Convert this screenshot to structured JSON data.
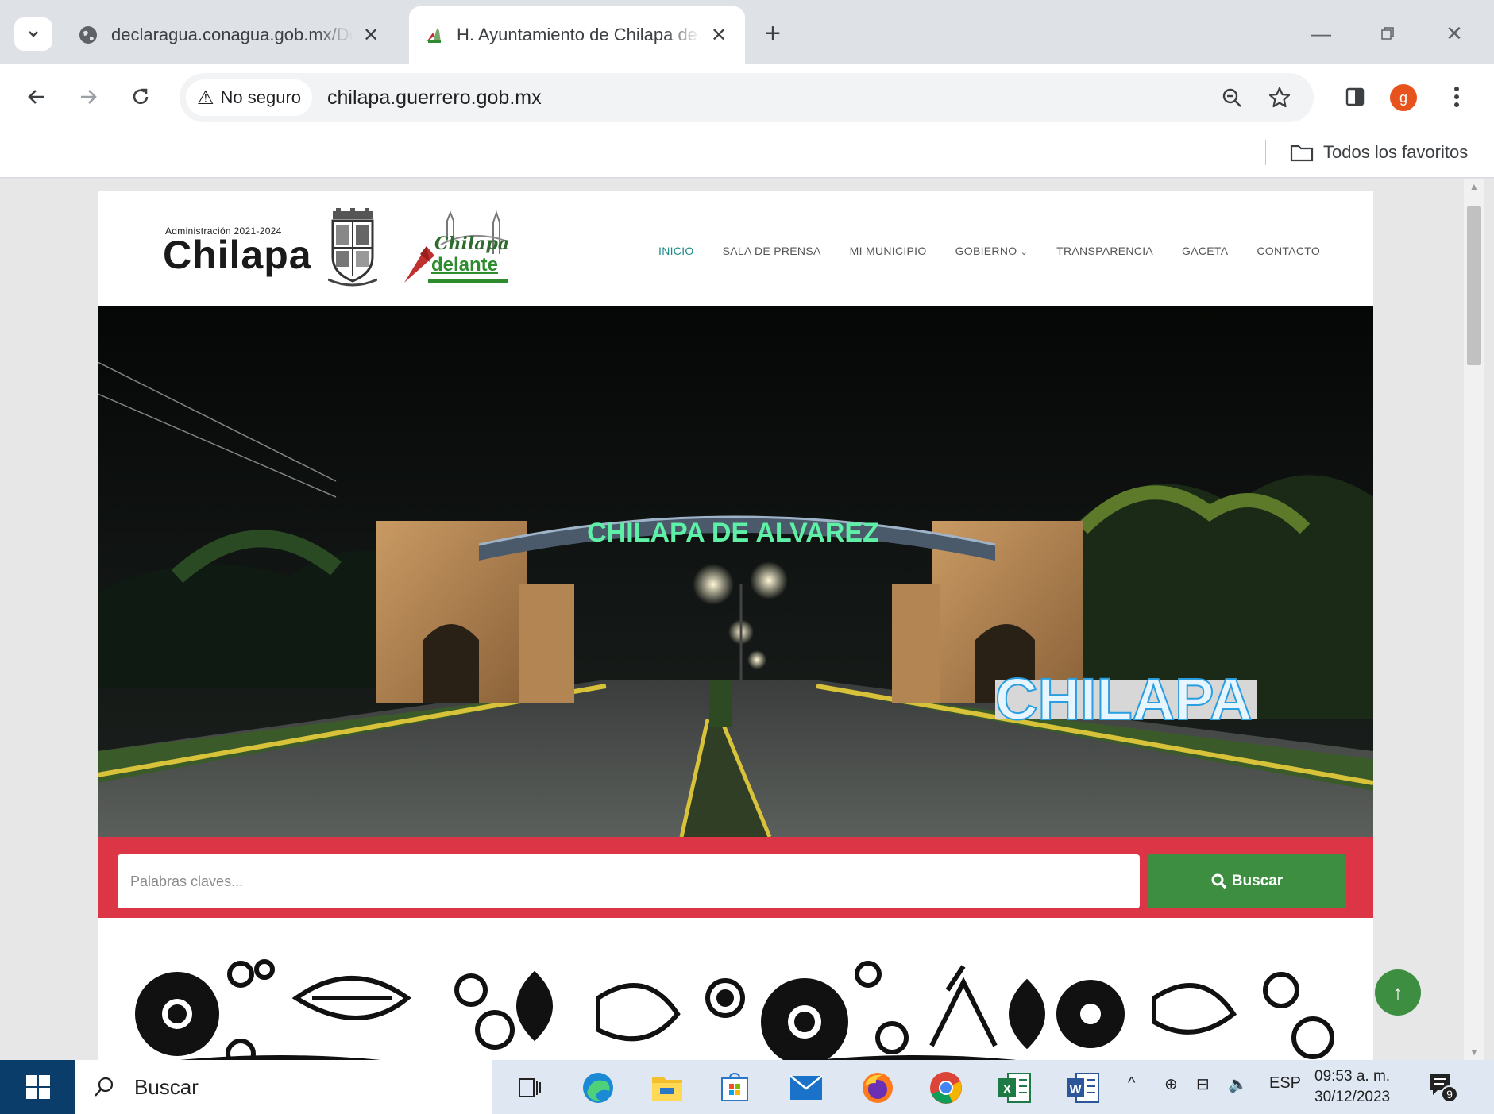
{
  "browser": {
    "tabs": [
      {
        "title": "declaragua.conagua.gob.mx/De",
        "active": false
      },
      {
        "title": "H. Ayuntamiento de Chilapa de",
        "active": true
      }
    ],
    "security_label": "No seguro",
    "url": "chilapa.guerrero.gob.mx",
    "profile_initial": "g",
    "bookmarks_folder": "Todos los favoritos"
  },
  "site": {
    "logo": {
      "admin_text": "Administración 2021-2024",
      "name": "Chilapa",
      "slogan_top": "Chilapa",
      "slogan_bottom": "delante"
    },
    "nav": [
      {
        "label": "INICIO",
        "active": true
      },
      {
        "label": "SALA DE PRENSA",
        "active": false
      },
      {
        "label": "MI MUNICIPIO",
        "active": false
      },
      {
        "label": "GOBIERNO",
        "active": false,
        "dropdown": true
      },
      {
        "label": "TRANSPARENCIA",
        "active": false
      },
      {
        "label": "GACETA",
        "active": false
      },
      {
        "label": "CONTACTO",
        "active": false
      }
    ],
    "hero": {
      "arch_text": "CHILAPA DE ALVAREZ",
      "sign_text": "CHILAPA"
    },
    "search": {
      "placeholder": "Palabras claves...",
      "button_label": "Buscar"
    },
    "colors": {
      "accent_red": "#dc3545",
      "accent_green": "#3e8e41",
      "nav_active": "#1e8a8a"
    }
  },
  "taskbar": {
    "search_label": "Buscar",
    "language": "ESP",
    "time": "09:53 a. m.",
    "date": "30/12/2023",
    "notification_count": "9"
  }
}
